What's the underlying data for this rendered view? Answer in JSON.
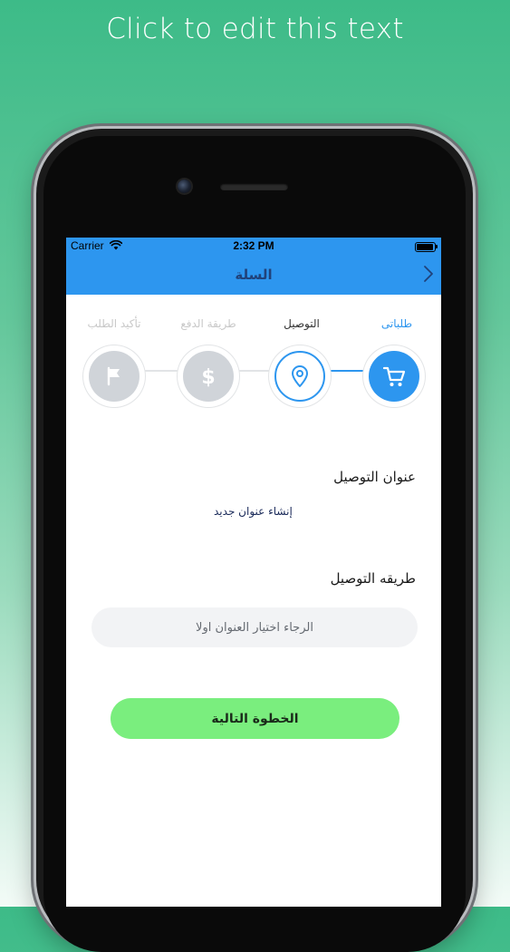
{
  "promo": {
    "headline": "Click to edit this text"
  },
  "status_bar": {
    "carrier": "Carrier",
    "time": "2:32 PM"
  },
  "nav": {
    "title": "السلة"
  },
  "stepper": {
    "steps": [
      {
        "label": "طلباتى",
        "icon": "cart-icon",
        "state": "completed"
      },
      {
        "label": "التوصيل",
        "icon": "location-pin-icon",
        "state": "current"
      },
      {
        "label": "طريقة الدفع",
        "icon": "dollar-icon",
        "state": "pending"
      },
      {
        "label": "تأكيد الطلب",
        "icon": "flag-icon",
        "state": "pending"
      }
    ]
  },
  "delivery_address": {
    "title": "عنوان التوصيل",
    "create_new_link": "إنشاء عنوان جديد"
  },
  "delivery_method": {
    "title": "طريقه التوصيل",
    "placeholder": "الرجاء اختيار العنوان اولا"
  },
  "actions": {
    "next_label": "الخطوة التالية"
  },
  "colors": {
    "primary": "#2d96ef",
    "nav_title": "#20427a",
    "next_button": "#7aee7e",
    "pending": "#d0d4d9",
    "background_gradient_top": "#3dbb88"
  }
}
